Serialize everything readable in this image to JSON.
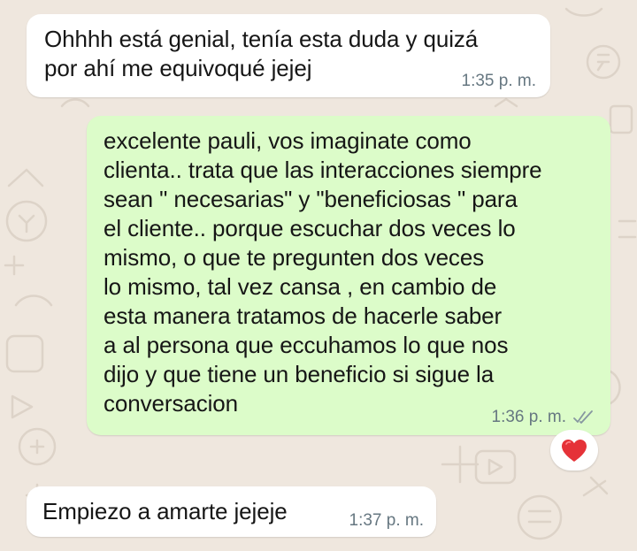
{
  "messages": [
    {
      "direction": "incoming",
      "text": "Ohhhh está genial, tenía esta duda y quizá\npor ahí me equivoqué jejej",
      "time": "1:35 p. m."
    },
    {
      "direction": "outgoing",
      "text": "excelente pauli, vos imaginate como\nclienta.. trata que las interacciones siempre\nsean \" necesarias\" y \"beneficiosas \" para\nel cliente.. porque escuchar dos veces lo\nmismo, o que te pregunten dos veces\nlo mismo, tal vez cansa , en cambio de\nesta manera tratamos de hacerle saber\na al persona que eccuhamos lo que nos\ndijo y que tiene un beneficio si sigue la\nconversacion",
      "time": "1:36 p. m.",
      "status_icon": "double-check-read-icon",
      "reaction_icon": "red-heart-icon"
    },
    {
      "direction": "incoming",
      "text": "Empiezo a amarte jejeje",
      "time": "1:37 p. m."
    }
  ],
  "colors": {
    "wallpaper": "#efe7de",
    "incoming_bubble": "#ffffff",
    "outgoing_bubble": "#dcfcc9",
    "message_text": "#161616",
    "timestamp": "#667781",
    "reaction_heart": "#e53238"
  }
}
